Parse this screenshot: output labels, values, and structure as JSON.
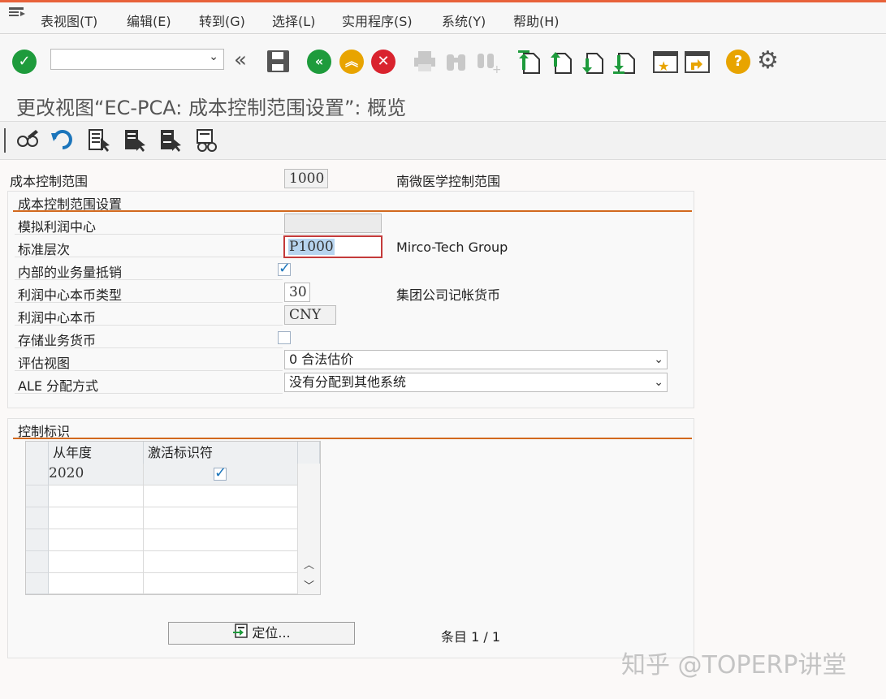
{
  "menubar": {
    "items": [
      "表视图(T)",
      "编辑(E)",
      "转到(G)",
      "选择(L)",
      "实用程序(S)",
      "系统(Y)",
      "帮助(H)"
    ]
  },
  "toolbar": {
    "command_field_value": "",
    "icons": [
      "enter-icon",
      "back-double-icon",
      "save-icon",
      "back-icon",
      "exit-icon",
      "cancel-icon",
      "print-icon",
      "find-icon",
      "find-next-icon",
      "first-page-icon",
      "prev-page-icon",
      "next-page-icon",
      "last-page-icon",
      "create-session-icon",
      "shortcut-icon",
      "help-icon",
      "settings-icon"
    ]
  },
  "title": "更改视图“EC-PCA: 成本控制范围设置”: 概览",
  "app_toolbar": {
    "icons": [
      "display-change-icon",
      "undo-icon",
      "select-all-icon",
      "select-block-icon",
      "deselect-all-icon",
      "compare-icon"
    ]
  },
  "header": {
    "label": "成本控制范围",
    "value": "1000",
    "desc": "南微医学控制范围"
  },
  "settings_group": {
    "title": "成本控制范围设置",
    "rows": {
      "sim_profit_center": {
        "label": "模拟利润中心",
        "value": ""
      },
      "std_hierarchy": {
        "label": "标准层次",
        "value": "P1000",
        "desc": "Mirco-Tech Group"
      },
      "internal_offset": {
        "label": "内部的业务量抵销",
        "checked": true
      },
      "pc_currency_type": {
        "label": "利润中心本币类型",
        "value": "30",
        "desc": "集团公司记帐货币"
      },
      "pc_currency": {
        "label": "利润中心本币",
        "value": "CNY"
      },
      "store_txn_currency": {
        "label": "存储业务货币",
        "checked": false
      },
      "valuation_view": {
        "label": "评估视图",
        "value": "0 合法估价"
      },
      "ale_method": {
        "label": "ALE 分配方式",
        "value": "没有分配到其他系统"
      }
    }
  },
  "control_group": {
    "title": "控制标识",
    "columns": [
      "从年度",
      "激活标识符"
    ],
    "rows": [
      {
        "year": "2020",
        "active": true
      }
    ],
    "position_button": "定位...",
    "entry_text": "条目 1 / 1"
  },
  "watermark": "知乎 @TOPERP讲堂"
}
